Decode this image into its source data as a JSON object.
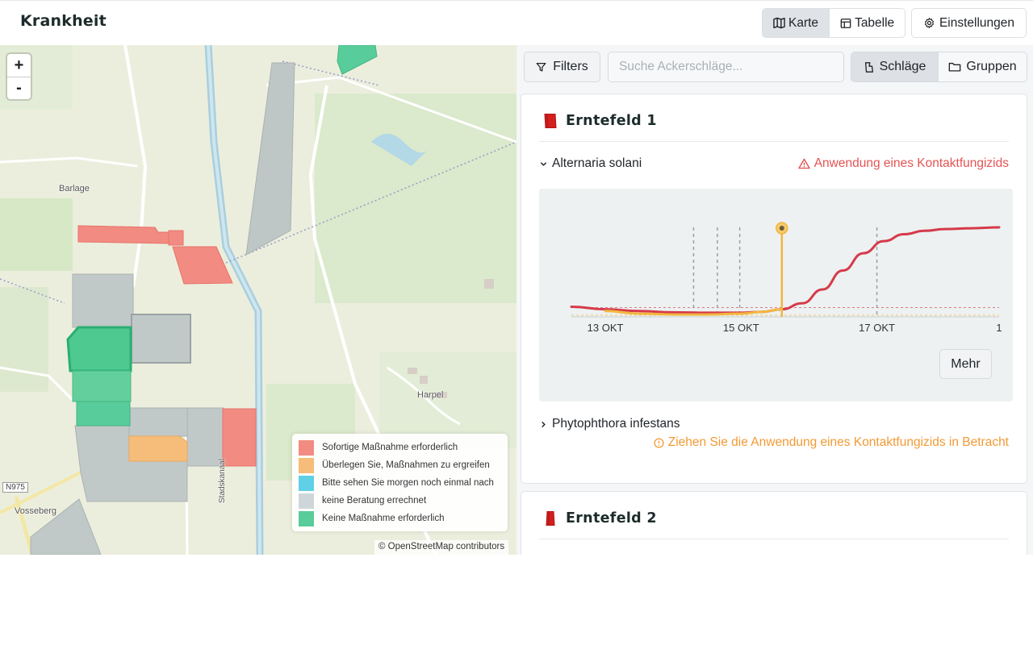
{
  "header": {
    "title": "Krankheit",
    "view_map": "Karte",
    "view_table": "Tabelle",
    "settings": "Einstellungen"
  },
  "map": {
    "zoom_in": "+",
    "zoom_out": "-",
    "places": [
      "Barlage",
      "Harpel",
      "Stadskanaal",
      "Vosseberg",
      "N975"
    ],
    "attribution": "© OpenStreetMap contributors",
    "legend": [
      {
        "label": "Sofortige Maßnahme erforderlich",
        "color": "#f28b82"
      },
      {
        "label": "Überlegen Sie, Maßnahmen zu ergreifen",
        "color": "#f6bd7a"
      },
      {
        "label": "Bitte sehen Sie morgen noch einmal nach",
        "color": "#5fd0e6"
      },
      {
        "label": "keine Beratung errechnet",
        "color": "#cfd6d9"
      },
      {
        "label": "Keine Maßnahme erforderlich",
        "color": "#58cc9a"
      }
    ]
  },
  "panel": {
    "filters": "Filters",
    "search_placeholder": "Suche Ackerschläge...",
    "toggle_fields": "Schläge",
    "toggle_groups": "Gruppen",
    "fields": [
      {
        "name": "Erntefeld 1",
        "diseases": [
          {
            "name": "Alternaria solani",
            "advice": "Anwendung eines Kontaktfungizids",
            "level": "red",
            "expanded": true
          },
          {
            "name": "Phytophthora infestans",
            "advice": "Ziehen Sie die Anwendung eines Kontaktfungizids in Betracht",
            "level": "orange",
            "expanded": false
          }
        ],
        "more": "Mehr"
      },
      {
        "name": "Erntefeld 2"
      }
    ]
  },
  "chart_data": {
    "type": "line",
    "x_ticks": [
      "13 OKT",
      "15 OKT",
      "17 OKT",
      "1"
    ],
    "x_domain": [
      12.5,
      18.8
    ],
    "y_domain": [
      0,
      1
    ],
    "series": [
      {
        "color": "#d63a4a",
        "x": [
          12.5,
          13.0,
          13.5,
          14.0,
          14.5,
          15.0,
          15.3,
          15.6,
          15.9,
          16.2,
          16.5,
          16.8,
          17.1,
          17.4,
          17.7,
          18.0,
          18.4,
          18.8
        ],
        "y": [
          0.08,
          0.05,
          0.03,
          0.015,
          0.01,
          0.01,
          0.02,
          0.05,
          0.12,
          0.28,
          0.5,
          0.7,
          0.84,
          0.92,
          0.96,
          0.98,
          0.99,
          1.0
        ]
      },
      {
        "color": "#f3b63f",
        "x": [
          13.0,
          13.5,
          14.0,
          14.5,
          15.0,
          15.3,
          15.6
        ],
        "y": [
          0.03,
          0.0,
          -0.01,
          -0.01,
          0.0,
          0.02,
          0.05
        ]
      }
    ],
    "threshold_red": 0.07,
    "threshold_orange": 0.0,
    "vertical_dashed_x": [
      14.3,
      14.65,
      14.98,
      17.0
    ],
    "marker_x": 15.6,
    "colors": {
      "risk_line": "#d63a4a",
      "forecast_line": "#f3b63f",
      "grid": "#9aa0a3"
    }
  }
}
